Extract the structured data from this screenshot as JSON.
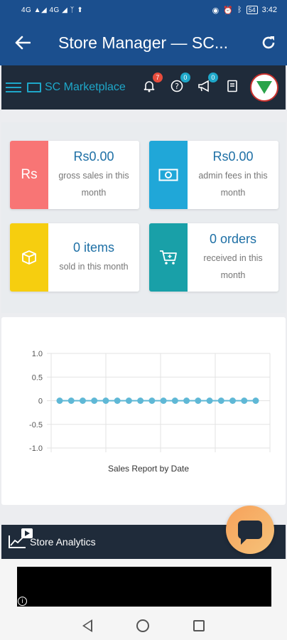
{
  "status_bar": {
    "left_text": "4G ▲◢ 4G ◢ ᛉ ⬆",
    "time": "3:42",
    "battery": "54"
  },
  "app_bar": {
    "title": "Store Manager — SC...",
    "back_icon": "arrow-left-icon",
    "refresh_icon": "refresh-icon"
  },
  "toolbar": {
    "store_name": "SC Marketplace",
    "notifications_badge": "7",
    "help_badge": "0",
    "announcements_badge": "0"
  },
  "cards": [
    {
      "icon_text": "Rs",
      "value": "Rs0.00",
      "label": "gross sales in this month",
      "color": "#f87575"
    },
    {
      "icon_text": "",
      "value": "Rs0.00",
      "label": "admin fees in this month",
      "color": "#20a7d8"
    },
    {
      "icon_text": "",
      "value": "0 items",
      "label": "sold in this month",
      "color": "#f6ce0f"
    },
    {
      "icon_text": "",
      "value": "0 orders",
      "label": "received in this month",
      "color": "#19a0a8"
    }
  ],
  "chart_data": {
    "type": "line",
    "xlabel": "Sales Report by Date",
    "ylabel": "",
    "ylim": [
      -1.0,
      1.0
    ],
    "yticks": [
      "1.0",
      "0.5",
      "0",
      "-0.5",
      "-1.0"
    ],
    "grid": true,
    "series": [
      {
        "values": [
          0,
          0,
          0,
          0,
          0,
          0,
          0,
          0,
          0,
          0,
          0,
          0,
          0,
          0,
          0,
          0,
          0,
          0
        ],
        "color": "#5fb8d6"
      }
    ]
  },
  "analytics": {
    "label": "Store Analytics"
  },
  "colors": {
    "primary": "#1b4f8e",
    "dark": "#1f2b3a",
    "accent": "#1ea7c9",
    "value_text": "#1d6fa5"
  }
}
